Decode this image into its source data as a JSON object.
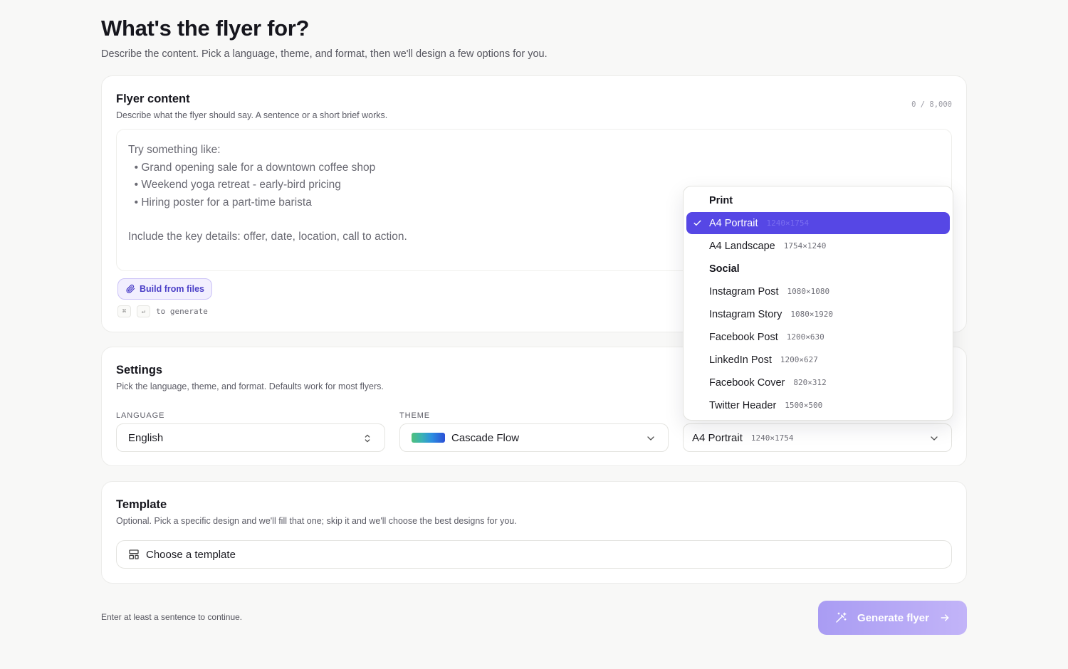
{
  "header": {
    "title": "What's the flyer for?",
    "subtitle": "Describe the content. Pick a language, theme, and format, then we'll design a few options for you."
  },
  "content_card": {
    "title": "Flyer content",
    "description": "Describe what the flyer should say. A sentence or a short brief works.",
    "counter": "0 / 8,000",
    "placeholder_lines": [
      "Try something like:",
      "  • Grand opening sale for a downtown coffee shop",
      "  • Weekend yoga retreat - early-bird pricing",
      "  • Hiring poster for a part-time barista",
      "Include the key details: offer, date, location, call to action."
    ],
    "build_from_files_label": "Build from files",
    "shortcut_key1": "⌘",
    "shortcut_key2": "↵",
    "shortcut_text": "to generate"
  },
  "settings_card": {
    "title": "Settings",
    "description": "Pick the language, theme, and format. Defaults work for most flyers.",
    "language_label": "LANGUAGE",
    "language_value": "English",
    "theme_label": "THEME",
    "theme_value": "Cascade Flow",
    "format_value": "A4 Portrait",
    "format_dims": "1240×1754"
  },
  "template_card": {
    "title": "Template",
    "description": "Optional. Pick a specific design and we'll fill that one; skip it and we'll choose the best designs for you.",
    "button_label": "Choose a template"
  },
  "footer": {
    "hint": "Enter at least a sentence to continue.",
    "generate_label": "Generate flyer"
  },
  "format_dropdown": {
    "groups": [
      {
        "name": "Print",
        "items": [
          {
            "label": "A4 Portrait",
            "dims": "1240×1754",
            "selected": true
          },
          {
            "label": "A4 Landscape",
            "dims": "1754×1240"
          }
        ]
      },
      {
        "name": "Social",
        "items": [
          {
            "label": "Instagram Post",
            "dims": "1080×1080"
          },
          {
            "label": "Instagram Story",
            "dims": "1080×1920"
          },
          {
            "label": "Facebook Post",
            "dims": "1200×630"
          },
          {
            "label": "LinkedIn Post",
            "dims": "1200×627"
          },
          {
            "label": "Facebook Cover",
            "dims": "820×312"
          },
          {
            "label": "Twitter Header",
            "dims": "1500×500"
          }
        ]
      }
    ]
  },
  "colors": {
    "accent": "#5647e5",
    "generate_button": "#b0a3f5"
  },
  "icons": {
    "paperclip": "paperclip-icon",
    "chevron": "chevron-down-icon",
    "updown": "chevron-up-down-icon",
    "template": "layout-template-icon",
    "wand": "magic-wand-icon",
    "arrow": "arrow-right-icon",
    "check": "check-icon"
  }
}
